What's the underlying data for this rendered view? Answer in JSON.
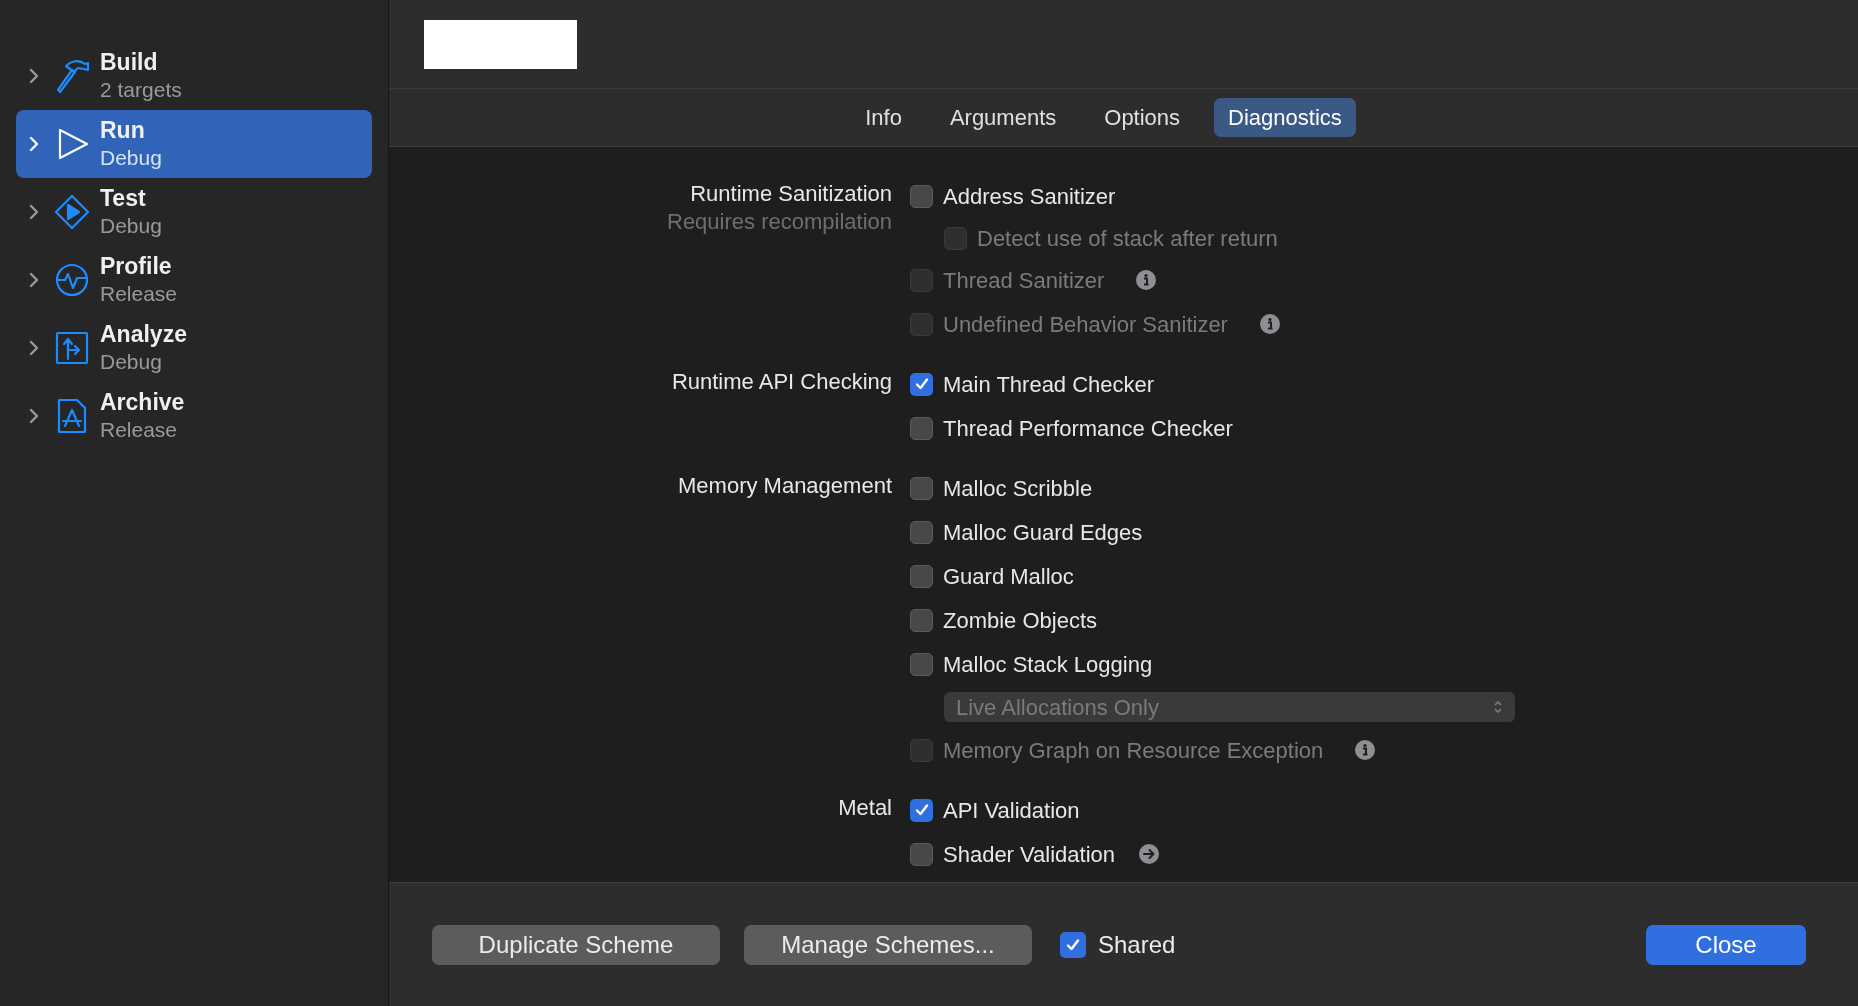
{
  "sidebar": {
    "items": [
      {
        "title": "Build",
        "subtitle": "2 targets",
        "selected": false,
        "expanded": false
      },
      {
        "title": "Run",
        "subtitle": "Debug",
        "selected": true,
        "expanded": false
      },
      {
        "title": "Test",
        "subtitle": "Debug",
        "selected": false,
        "expanded": false
      },
      {
        "title": "Profile",
        "subtitle": "Release",
        "selected": false,
        "expanded": false
      },
      {
        "title": "Analyze",
        "subtitle": "Debug",
        "selected": false,
        "expanded": false
      },
      {
        "title": "Archive",
        "subtitle": "Release",
        "selected": false,
        "expanded": false
      }
    ]
  },
  "tabs": [
    {
      "label": "Info",
      "selected": false
    },
    {
      "label": "Arguments",
      "selected": false
    },
    {
      "label": "Options",
      "selected": false
    },
    {
      "label": "Diagnostics",
      "selected": true
    }
  ],
  "sections": [
    {
      "label": "Runtime Sanitization",
      "sublabel": "Requires recompilation",
      "items": [
        {
          "kind": "checkbox",
          "label": "Address Sanitizer",
          "checked": false,
          "disabled": false,
          "children": [
            {
              "kind": "checkbox",
              "label": "Detect use of stack after return",
              "checked": false,
              "disabled": true
            }
          ]
        },
        {
          "kind": "checkbox",
          "label": "Thread Sanitizer",
          "checked": false,
          "disabled": true,
          "has_info": true
        },
        {
          "kind": "checkbox",
          "label": "Undefined Behavior Sanitizer",
          "checked": false,
          "disabled": true,
          "has_info": true
        }
      ]
    },
    {
      "label": "Runtime API Checking",
      "items": [
        {
          "kind": "checkbox",
          "label": "Main Thread Checker",
          "checked": true,
          "disabled": false
        },
        {
          "kind": "checkbox",
          "label": "Thread Performance Checker",
          "checked": false,
          "disabled": false
        }
      ]
    },
    {
      "label": "Memory Management",
      "items": [
        {
          "kind": "checkbox",
          "label": "Malloc Scribble",
          "checked": false,
          "disabled": false
        },
        {
          "kind": "checkbox",
          "label": "Malloc Guard Edges",
          "checked": false,
          "disabled": false
        },
        {
          "kind": "checkbox",
          "label": "Guard Malloc",
          "checked": false,
          "disabled": false
        },
        {
          "kind": "checkbox",
          "label": "Zombie Objects",
          "checked": false,
          "disabled": false
        },
        {
          "kind": "checkbox",
          "label": "Malloc Stack Logging",
          "checked": false,
          "disabled": false,
          "children": [
            {
              "kind": "popup",
              "value": "Live Allocations Only",
              "disabled": true
            }
          ]
        },
        {
          "kind": "checkbox",
          "label": "Memory Graph on Resource Exception",
          "checked": false,
          "disabled": true,
          "has_info": true
        }
      ]
    },
    {
      "label": "Metal",
      "items": [
        {
          "kind": "checkbox",
          "label": "API Validation",
          "checked": true,
          "disabled": false
        },
        {
          "kind": "checkbox",
          "label": "Shader Validation",
          "checked": false,
          "disabled": false,
          "has_link": true
        }
      ]
    }
  ],
  "footer": {
    "buttons": [
      "Duplicate Scheme",
      "Manage Schemes..."
    ],
    "shared": {
      "label": "Shared",
      "checked": true
    },
    "close": "Close"
  }
}
